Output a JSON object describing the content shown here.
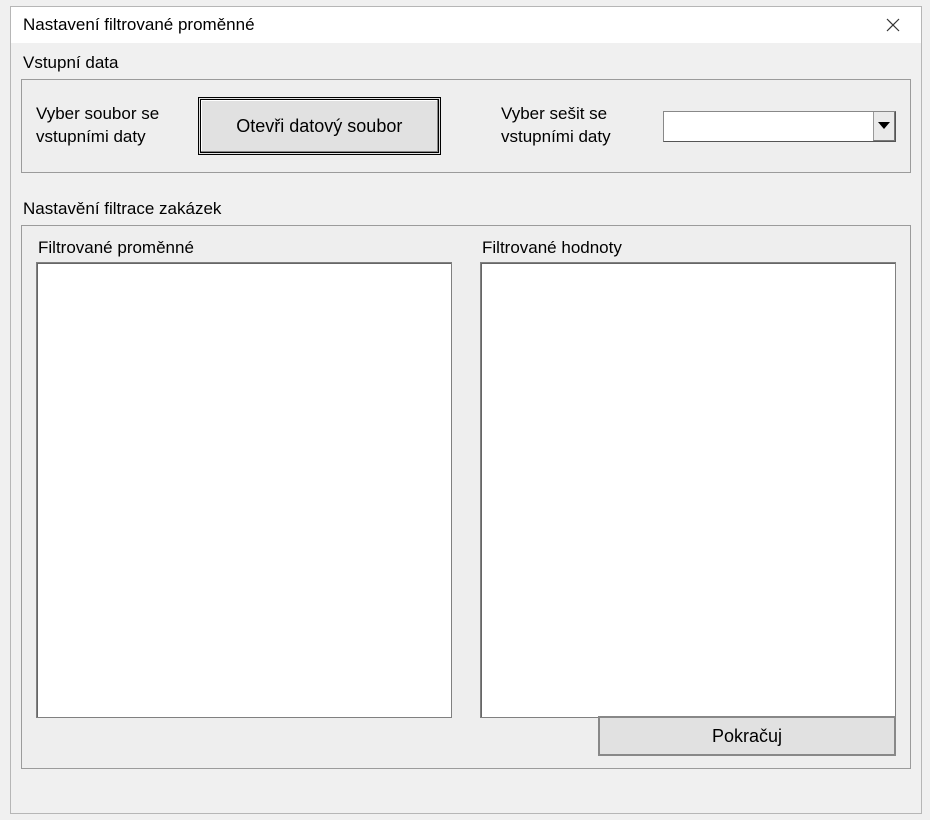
{
  "dialog": {
    "title": "Nastavení filtrované proměnné"
  },
  "input_data": {
    "section_label": "Vstupní data",
    "file_label": "Vyber soubor se vstupními daty",
    "open_button_label": "Otevři datový soubor",
    "sheet_label": "Vyber sešit se vstupními daty",
    "sheet_value": ""
  },
  "filter_settings": {
    "section_label": "Nastavění filtrace zakázek",
    "variables_label": "Filtrované proměnné",
    "values_label": "Filtrované hodnoty",
    "continue_label": "Pokračuj"
  }
}
